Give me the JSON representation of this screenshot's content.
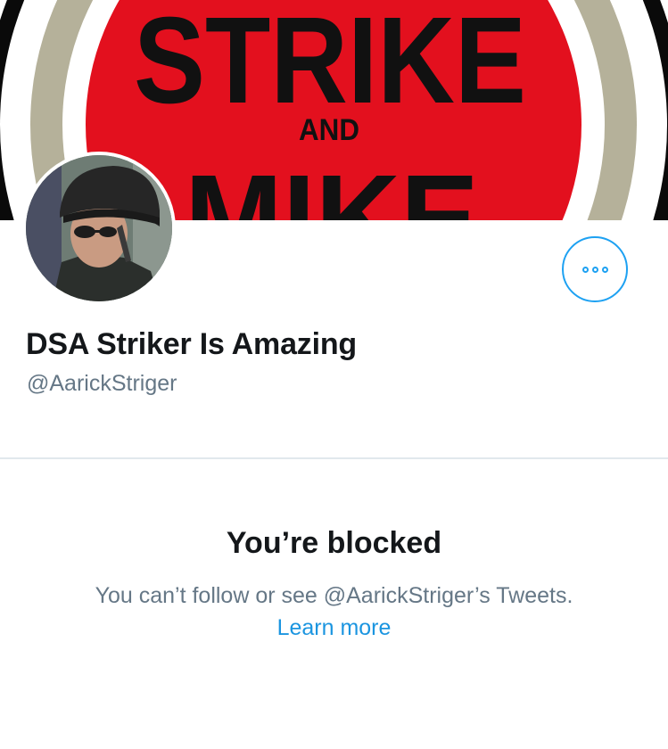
{
  "banner": {
    "line1": "STRIKE",
    "line2": "AND",
    "line3": "MIKE",
    "colors": {
      "red": "#e3101e",
      "ring_outer": "#0a0a0a",
      "ring_middle": "#b5b19a",
      "text": "#111111"
    }
  },
  "profile": {
    "display_name": "DSA Striker Is Amazing",
    "handle": "@AarickStriger",
    "avatar_icon": "profile-photo"
  },
  "actions": {
    "more_icon": "ellipsis-icon",
    "accent": "#1da1f2"
  },
  "blocked": {
    "title": "You’re blocked",
    "description": "You can’t follow or see @AarickStriger’s Tweets.",
    "learn_more": "Learn more"
  }
}
